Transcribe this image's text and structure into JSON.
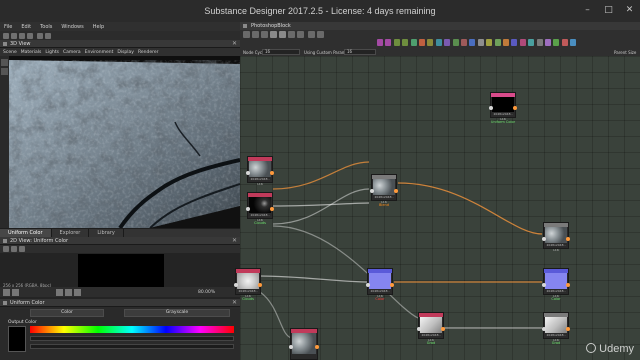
{
  "window": {
    "title": "Substance Designer 2017.2.5 - License: 4 days remaining"
  },
  "menu": [
    "File",
    "Edit",
    "Tools",
    "Windows",
    "Help"
  ],
  "view_panel": {
    "title": "3D View",
    "menu": [
      "Scene",
      "Materials",
      "Lights",
      "Camera",
      "Environment",
      "Display",
      "Renderer"
    ]
  },
  "bottom_tabs": [
    "Uniform Color",
    "Explorer",
    "Library"
  ],
  "preview_2d": {
    "title": "2D View: Uniform Color",
    "info": "256 x 256 (RGBA, 8bpc)",
    "zoom": "80.00%",
    "swatch_color": "#000000"
  },
  "properties": {
    "title": "Uniform Color",
    "buttons": [
      "Color",
      "Grayscale"
    ],
    "output_label": "Output Color"
  },
  "graph": {
    "title": "PhotoshopBlock",
    "node_cycle_label": "Node Cycle",
    "node_cycle_value": "16",
    "custom_param_label": "Using Custom Parameter",
    "custom_param_value": "16",
    "parent_size_label": "Parent Size",
    "atom_colors": [
      "#a44aa4",
      "#a44aa4",
      "#6e8e3e",
      "#6e8e3e",
      "#4e9e6e",
      "#c06040",
      "#8a8a3a",
      "#3e8e9e",
      "#7a5ab0",
      "#5a8e4e",
      "#9e5a5a",
      "#4a6ec0",
      "#8e8e8e",
      "#a0a040",
      "#6ea05a",
      "#c07a3a",
      "#5a5ac0",
      "#b04a7a",
      "#4aa0a0",
      "#7a7a7a",
      "#9e6ec0",
      "#5aa04a",
      "#c05a5a",
      "#4a8ec0"
    ]
  },
  "nodes": [
    {
      "name": "uniform-color-node",
      "header_color": "#d94b8b",
      "thumb": "#000000",
      "meta": "2048x2048 - L16",
      "caption": "Uniform Color",
      "caption_color": "#6fe36f"
    },
    {
      "name": "grunge-node-a",
      "header_color": "#c13a5a",
      "thumb": "grunge",
      "meta": "2048x2048 - L16",
      "caption": "",
      "caption_color": "#6fe36f"
    },
    {
      "name": "noise-node-b",
      "header_color": "#c13a5a",
      "thumb": "dark-speckle",
      "meta": "2048x2048 - L16",
      "caption": "Clouds",
      "caption_color": "#6fe36f"
    },
    {
      "name": "blend-node",
      "header_color": "#7a7a7a",
      "thumb": "grunge",
      "meta": "2048x2048 - L16",
      "caption": "Blend",
      "caption_color": "#ff8c1a"
    },
    {
      "name": "output-node-right-a",
      "header_color": "#7a7a7a",
      "thumb": "grunge",
      "meta": "2048x2048 - L16",
      "caption": "",
      "caption_color": "#6fe36f"
    },
    {
      "name": "levels-node-left",
      "header_color": "#c13a5a",
      "thumb": "light",
      "meta": "2048x2048 - L16",
      "caption": "Clouds",
      "caption_color": "#6fe36f"
    },
    {
      "name": "color-node-mid",
      "header_color": "#5a5ad9",
      "thumb": "#8585f0",
      "meta": "2048x2048 - L16",
      "caption": "Color",
      "caption_color": "#ff3b3b"
    },
    {
      "name": "color-node-right",
      "header_color": "#5a5ad9",
      "thumb": "#8585f0",
      "meta": "2048x2048 - L16",
      "caption": "Color",
      "caption_color": "#6fe36f"
    },
    {
      "name": "gradient-node-mid",
      "header_color": "#c13a5a",
      "thumb": "light-gradient",
      "meta": "2048x2048 - L16",
      "caption": "Grad",
      "caption_color": "#6fe36f"
    },
    {
      "name": "gradient-node-right",
      "header_color": "#7a7a7a",
      "thumb": "light-gradient",
      "meta": "2048x2048 - L16",
      "caption": "Grad",
      "caption_color": "#6fe36f"
    },
    {
      "name": "image-input-node",
      "header_color": "#c13a5a",
      "thumb": "grunge",
      "meta": "",
      "caption": "",
      "caption_color": "#6fe36f"
    }
  ],
  "watermark": "Udemy"
}
